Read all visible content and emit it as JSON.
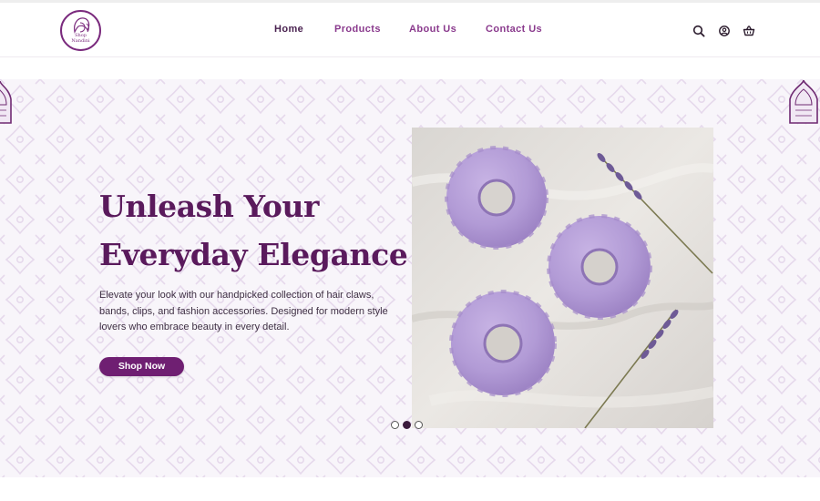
{
  "brand": {
    "logo_line1": "Shop",
    "logo_line2": "Nandini",
    "color": "#7a2a7d"
  },
  "nav": {
    "items": [
      {
        "label": "Home",
        "active": true
      },
      {
        "label": "Products",
        "active": false
      },
      {
        "label": "About Us",
        "active": false
      },
      {
        "label": "Contact Us",
        "active": false
      }
    ]
  },
  "header_icons": [
    "search-icon",
    "user-icon",
    "cart-icon"
  ],
  "hero": {
    "headline_line1": "Unleash Your",
    "headline_line2": "Everyday Elegance",
    "description": "Elevate your look with our handpicked collection of hair claws, bands, clips, and fashion accessories. Designed for modern style lovers who embrace beauty in every detail.",
    "cta_label": "Shop Now",
    "accent_color": "#6f1f72",
    "slider": {
      "total": 3,
      "active": 2
    }
  }
}
